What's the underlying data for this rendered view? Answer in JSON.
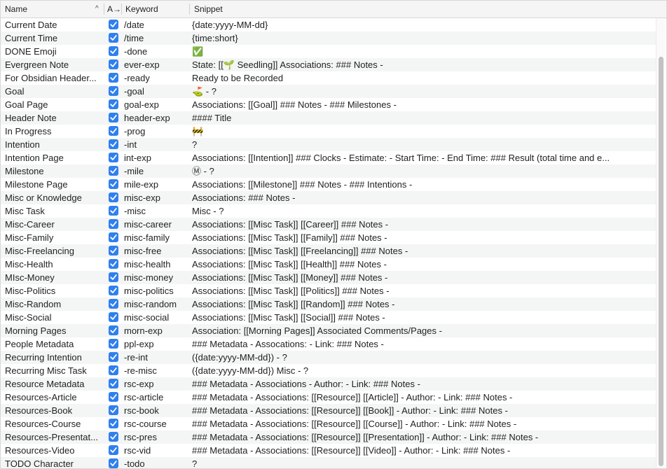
{
  "header": {
    "name_label": "Name",
    "sort_indicator": "^",
    "auto_label": "A→",
    "keyword_label": "Keyword",
    "snippet_label": "Snippet"
  },
  "colors": {
    "checkbox": "#2f80ed",
    "stripe": "#f4f5f5"
  },
  "rows": [
    {
      "name": "Current Date",
      "enabled": true,
      "keyword": "/date",
      "snippet": "{date:yyyy-MM-dd}"
    },
    {
      "name": "Current Time",
      "enabled": true,
      "keyword": "/time",
      "snippet": "{time:short}"
    },
    {
      "name": "DONE Emoji",
      "enabled": true,
      "keyword": "-done",
      "snippet": "✅"
    },
    {
      "name": "Evergreen Note",
      "enabled": true,
      "keyword": "ever-exp",
      "snippet": "State: [[🌱 Seedling]]   Associations:  ### Notes -"
    },
    {
      "name": "For Obsidian Header...",
      "enabled": true,
      "keyword": "-ready",
      "snippet": "Ready to be Recorded"
    },
    {
      "name": "Goal",
      "enabled": true,
      "keyword": "-goal",
      "snippet": "⛳ - ?"
    },
    {
      "name": "Goal Page",
      "enabled": true,
      "keyword": "goal-exp",
      "snippet": "Associations: [[Goal]]  ### Notes -    ### Milestones -"
    },
    {
      "name": "Header Note",
      "enabled": true,
      "keyword": "header-exp",
      "snippet": "#### Title"
    },
    {
      "name": "In Progress",
      "enabled": true,
      "keyword": "-prog",
      "snippet": "🚧"
    },
    {
      "name": "Intention",
      "enabled": true,
      "keyword": "-int",
      "snippet": "?"
    },
    {
      "name": "Intention Page",
      "enabled": true,
      "keyword": "int-exp",
      "snippet": "Associations: [[Intention]]  ### Clocks - Estimate:  - Start Time:  - End Time:   ### Result (total time and e..."
    },
    {
      "name": "Milestone",
      "enabled": true,
      "keyword": "-mile",
      "snippet": "Ⓜ - ?"
    },
    {
      "name": "Milestone Page",
      "enabled": true,
      "keyword": "mile-exp",
      "snippet": "Associations: [[Milestone]]  ### Notes -    ### Intentions -"
    },
    {
      "name": "Misc or Knowledge",
      "enabled": true,
      "keyword": "misc-exp",
      "snippet": "Associations:   ### Notes  -"
    },
    {
      "name": "Misc Task",
      "enabled": true,
      "keyword": "-misc",
      "snippet": "Misc - ?"
    },
    {
      "name": "Misc-Career",
      "enabled": true,
      "keyword": "misc-career",
      "snippet": "Associations: [[Misc Task]] [[Career]]  ### Notes -"
    },
    {
      "name": "Misc-Family",
      "enabled": true,
      "keyword": "misc-family",
      "snippet": "Associations: [[Misc Task]] [[Family]]  ### Notes -"
    },
    {
      "name": "Misc-Freelancing",
      "enabled": true,
      "keyword": "misc-free",
      "snippet": "Associations: [[Misc Task]] [[Freelancing]]  ### Notes -"
    },
    {
      "name": "Misc-Health",
      "enabled": true,
      "keyword": "misc-health",
      "snippet": "Associations: [[Misc Task]] [[Health]]  ### Notes -"
    },
    {
      "name": "MIsc-Money",
      "enabled": true,
      "keyword": "misc-money",
      "snippet": "Associations: [[Misc Task]] [[Money]]  ### Notes -"
    },
    {
      "name": "Misc-Politics",
      "enabled": true,
      "keyword": "misc-politics",
      "snippet": "Associations: [[Misc Task]] [[Politics]]  ### Notes -"
    },
    {
      "name": "Misc-Random",
      "enabled": true,
      "keyword": "misc-random",
      "snippet": "Associations: [[Misc Task]] [[Random]]  ### Notes -"
    },
    {
      "name": "Misc-Social",
      "enabled": true,
      "keyword": "misc-social",
      "snippet": "Associations: [[Misc Task]] [[Social]]  ### Notes -"
    },
    {
      "name": "Morning Pages",
      "enabled": true,
      "keyword": "morn-exp",
      "snippet": "Association: [[Morning Pages]]   Associated Comments/Pages  -"
    },
    {
      "name": "People Metadata",
      "enabled": true,
      "keyword": "ppl-exp",
      "snippet": "### Metadata - Assocations: - Link:  ### Notes -"
    },
    {
      "name": "Recurring Intention",
      "enabled": true,
      "keyword": "-re-int",
      "snippet": "({date:yyyy-MM-dd}) - ?"
    },
    {
      "name": "Recurring Misc Task",
      "enabled": true,
      "keyword": "-re-misc",
      "snippet": "({date:yyyy-MM-dd}) Misc - ?"
    },
    {
      "name": "Resource Metadata",
      "enabled": true,
      "keyword": "rsc-exp",
      "snippet": "### Metadata - Associations - Author: - Link:  ### Notes -"
    },
    {
      "name": "Resources-Article",
      "enabled": true,
      "keyword": "rsc-article",
      "snippet": "### Metadata - Associations: [[Resource]] [[Article]] - Author: - Link:  ### Notes -"
    },
    {
      "name": "Resources-Book",
      "enabled": true,
      "keyword": "rsc-book",
      "snippet": "### Metadata - Associations: [[Resource]] [[Book]] - Author: - Link:  ### Notes -"
    },
    {
      "name": "Resources-Course",
      "enabled": true,
      "keyword": "rsc-course",
      "snippet": "### Metadata - Associations: [[Resource]] [[Course]] - Author: - Link:  ### Notes -"
    },
    {
      "name": "Resources-Presentat...",
      "enabled": true,
      "keyword": "rsc-pres",
      "snippet": "### Metadata - Associations: [[Resource]] [[Presentation]] - Author: - Link:  ### Notes -"
    },
    {
      "name": "Resources-Video",
      "enabled": true,
      "keyword": "rsc-vid",
      "snippet": "### Metadata - Associations: [[Resource]] [[Video]] - Author: - Link:  ### Notes -"
    },
    {
      "name": "TODO Character",
      "enabled": true,
      "keyword": "-todo",
      "snippet": "?"
    }
  ]
}
